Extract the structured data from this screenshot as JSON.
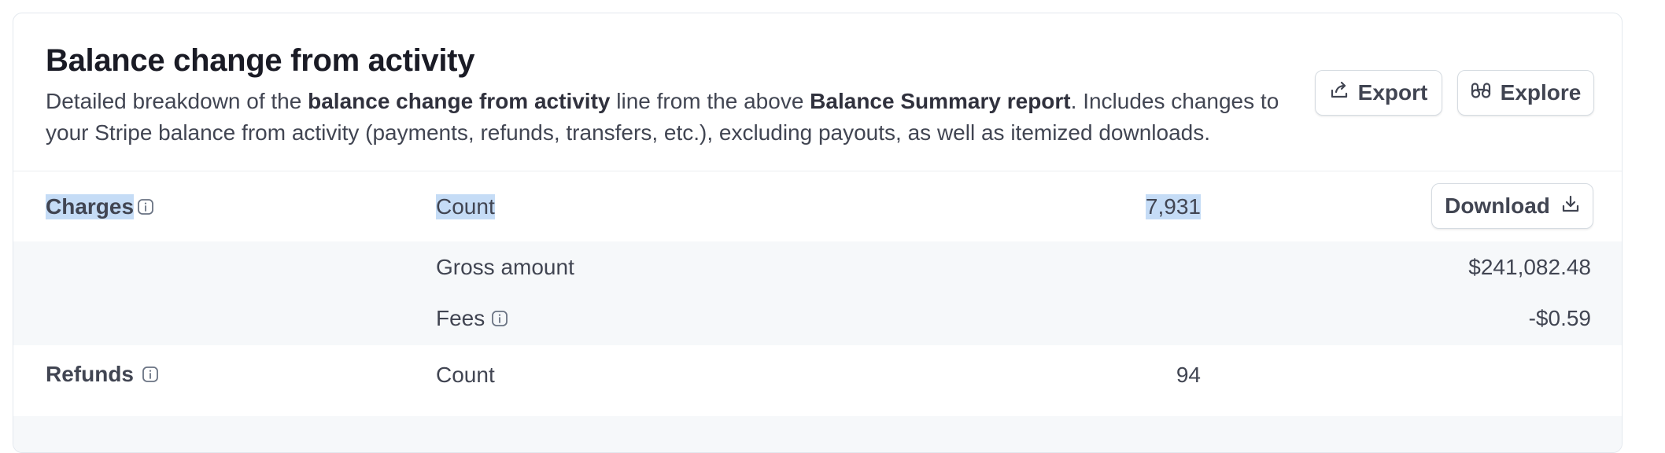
{
  "header": {
    "title": "Balance change from activity",
    "description": {
      "p1": "Detailed breakdown of the ",
      "b1": "balance change from activity",
      "p2": " line from the above ",
      "b2": "Balance Summary report",
      "p3": ". Includes changes to your Stripe balance from activity (payments, refunds, transfers, etc.), excluding payouts, as well as itemized downloads."
    },
    "export_label": "Export",
    "explore_label": "Explore"
  },
  "charges": {
    "label": "Charges",
    "count_label": "Count",
    "count_value": "7,931",
    "download_label": "Download",
    "gross_label": "Gross amount",
    "gross_value": "$241,082.48",
    "fees_label": "Fees",
    "fees_value": "-$0.59"
  },
  "refunds": {
    "label": "Refunds",
    "count_label": "Count",
    "count_value": "94"
  },
  "icons": {
    "export": "export-icon",
    "explore": "binoculars-icon",
    "download": "download-icon",
    "info": "info-icon"
  },
  "colors": {
    "selection": "#c5dcf6",
    "row_alt": "#f6f8fa",
    "text": "#414552"
  }
}
